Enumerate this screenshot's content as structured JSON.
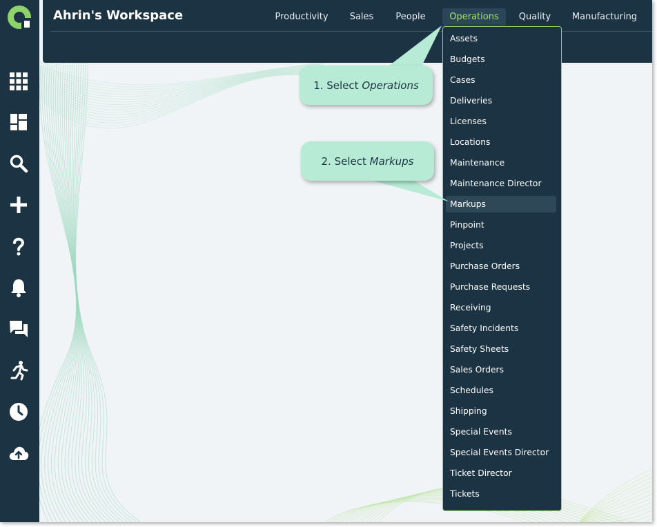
{
  "app": {
    "title": "Ahrin's Workspace"
  },
  "sidebar": {
    "icons": [
      {
        "name": "apps-grid-icon"
      },
      {
        "name": "dashboard-icon"
      },
      {
        "name": "search-icon"
      },
      {
        "name": "add-icon"
      },
      {
        "name": "help-icon"
      },
      {
        "name": "notifications-bell-icon"
      },
      {
        "name": "chat-icon"
      },
      {
        "name": "activity-runner-icon"
      },
      {
        "name": "clock-icon"
      },
      {
        "name": "cloud-upload-icon"
      }
    ]
  },
  "nav": {
    "items": [
      "Productivity",
      "Sales",
      "People",
      "Operations",
      "Quality",
      "Manufacturing"
    ],
    "active": "Operations"
  },
  "dropdown": {
    "items": [
      "Assets",
      "Budgets",
      "Cases",
      "Deliveries",
      "Licenses",
      "Locations",
      "Maintenance",
      "Maintenance Director",
      "Markups",
      "Pinpoint",
      "Projects",
      "Purchase Orders",
      "Purchase Requests",
      "Receiving",
      "Safety Incidents",
      "Safety Sheets",
      "Sales Orders",
      "Schedules",
      "Shipping",
      "Special Events",
      "Special Events Director",
      "Ticket Director",
      "Tickets"
    ],
    "highlighted": "Markups"
  },
  "callouts": {
    "step1_prefix": "1. Select ",
    "step1_target": "Operations",
    "step2_prefix": "2. Select ",
    "step2_target": "Markups"
  },
  "colors": {
    "sidebar": "#1c3343",
    "accent_green": "#a8e06a",
    "callout": "#b7ebd6",
    "background": "#f1f4f7"
  }
}
